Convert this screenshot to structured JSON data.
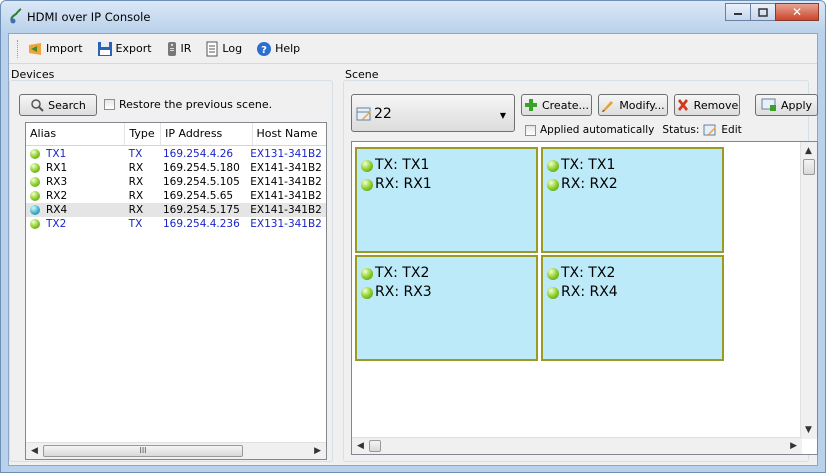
{
  "window": {
    "title": "HDMI over IP Console"
  },
  "toolbar": {
    "import": "Import",
    "export": "Export",
    "ir": "IR",
    "log": "Log",
    "help": "Help"
  },
  "devices": {
    "group_label": "Devices",
    "search_label": "Search",
    "restore_label": "Restore the previous scene.",
    "columns": [
      "Alias",
      "Type",
      "IP Address",
      "Host Name"
    ],
    "rows": [
      {
        "alias": "TX1",
        "type": "TX",
        "ip": "169.254.4.26",
        "host": "EX131-341B2"
      },
      {
        "alias": "RX1",
        "type": "RX",
        "ip": "169.254.5.180",
        "host": "EX141-341B2"
      },
      {
        "alias": "RX3",
        "type": "RX",
        "ip": "169.254.5.105",
        "host": "EX141-341B2"
      },
      {
        "alias": "RX2",
        "type": "RX",
        "ip": "169.254.5.65",
        "host": "EX141-341B2"
      },
      {
        "alias": "RX4",
        "type": "RX",
        "ip": "169.254.5.175",
        "host": "EX141-341B2"
      },
      {
        "alias": "TX2",
        "type": "TX",
        "ip": "169.254.4.236",
        "host": "EX131-341B2"
      }
    ],
    "scroll_grip": "III"
  },
  "scene": {
    "group_label": "Scene",
    "selected": "22",
    "create_label": "Create...",
    "modify_label": "Modify...",
    "remove_label": "Remove",
    "apply_label": "Apply",
    "applied_auto_label": "Applied automatically",
    "status_label": "Status:",
    "status_value": "Edit",
    "tiles": [
      {
        "tx": "TX: TX1",
        "rx": "RX: RX1"
      },
      {
        "tx": "TX: TX1",
        "rx": "RX: RX2"
      },
      {
        "tx": "TX: TX2",
        "rx": "RX: RX3"
      },
      {
        "tx": "TX: TX2",
        "rx": "RX: RX4"
      }
    ]
  },
  "colors": {
    "tx_text": "#1a24c9",
    "tile_fill": "#bdeaf8",
    "tile_border": "#9b9b23"
  }
}
